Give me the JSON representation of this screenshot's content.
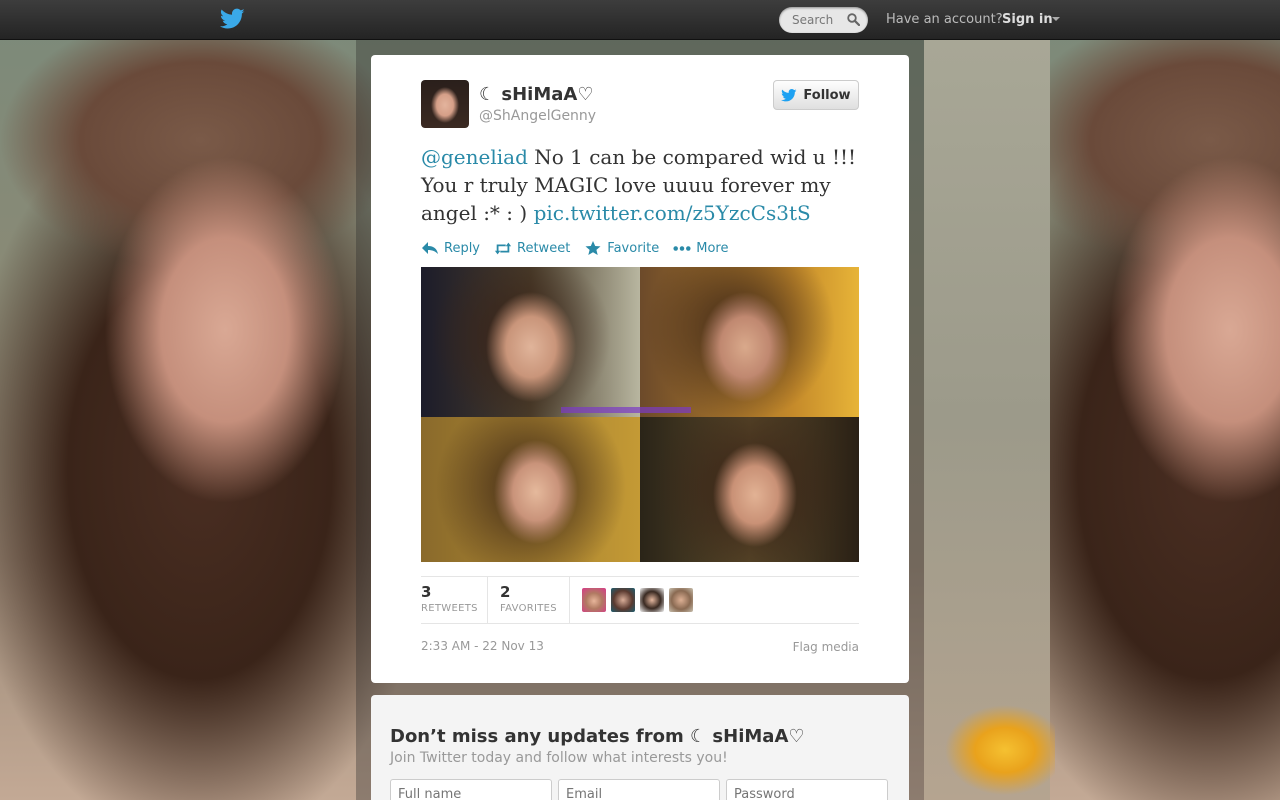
{
  "topbar": {
    "logo_icon": "twitter-bird-icon",
    "search_placeholder": "Search",
    "search_icon": "search-icon",
    "have_account": "Have an account?",
    "sign_in": "Sign in"
  },
  "tweet": {
    "display_name": "☾ sHiMaA♡",
    "screen_name": "@ShAngelGenny",
    "follow_label": "Follow",
    "mention": "@geneliad",
    "text_body": " No 1 can be compared wid u !!! You r truly MAGIC love uuuu forever my angel :* : ) ",
    "link": "pic.twitter.com/z5YzcCs3tS",
    "actions": {
      "reply": "Reply",
      "retweet": "Retweet",
      "favorite": "Favorite",
      "more": "More"
    },
    "stats": {
      "retweets_count": "3",
      "retweets_label": "RETWEETS",
      "favorites_count": "2",
      "favorites_label": "FAVORITES"
    },
    "timestamp": "2:33 AM - 22 Nov 13",
    "flag_media": "Flag media"
  },
  "signup": {
    "title": "Don’t miss any updates from ☾ sHiMaA♡",
    "subtitle": "Join Twitter today and follow what interests you!",
    "full_name_placeholder": "Full name",
    "email_placeholder": "Email",
    "password_placeholder": "Password"
  },
  "colors": {
    "link": "#2a8aa8",
    "twitter_blue": "#1da1f2",
    "topbar": "#2a2a2a"
  }
}
